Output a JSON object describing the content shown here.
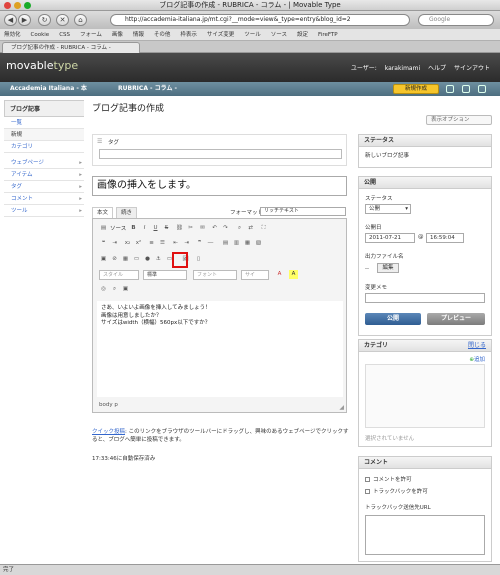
{
  "window": {
    "title": "ブログ記事の作成 - RUBRICA - コラム - | Movable Type"
  },
  "browser": {
    "url": "http://accademia-italiana.jp/mt.cgi?__mode=view&_type=entry&blog_id=2",
    "search_placeholder": "Google",
    "bookmarks": [
      "無効化",
      "Cookie",
      "CSS",
      "フォーム",
      "画像",
      "情報",
      "その他",
      "枠表示",
      "サイズ変更",
      "ツール",
      "ソース",
      "設定",
      "FireFTP"
    ],
    "tab_title": "ブログ記事の作成 - RUBRICA - コラム -",
    "status": "完了"
  },
  "app": {
    "logo_main": "movable",
    "logo_accent": "type",
    "user_label": "ユーザー:",
    "username": "karakimami",
    "help": "ヘルプ",
    "signout": "サインアウト",
    "blog_left": "Accademia Italiana - 本",
    "blog_right": "RUBRICA - コラム -",
    "new_button": "新規作成"
  },
  "sidebar": {
    "heading": "ブログ記事",
    "items": [
      {
        "label": "一覧",
        "active": true
      },
      {
        "label": "新規",
        "active": false
      },
      {
        "label": "カテゴリ",
        "active": true
      }
    ],
    "groups": [
      "ウェブページ",
      "アイテム",
      "タグ",
      "コメント",
      "ツール"
    ]
  },
  "page": {
    "title": "ブログ記事の作成",
    "display_options": "表示オプション",
    "tag_label": "タグ",
    "entry_title": "画像の挿入をします。",
    "tab_body": "本文",
    "tab_more": "続き",
    "format_label": "フォーマット:",
    "format_value": "リッチテキスト",
    "toolbar_source": "ソース",
    "style_placeholder": "スタイル",
    "heading_value": "標準",
    "font_placeholder": "フォント",
    "size_placeholder": "サイ",
    "body_lines": [
      "さあ、いよいよ画像を挿入してみましょう！",
      "画像は用意しましたか？",
      "サイズはwidth（横幅）560px以下ですか？"
    ],
    "editor_status": "body  p",
    "quickpost_link": "クイック投稿",
    "quickpost_text": ": このリンクをブラウザのツールバーにドラッグし、興味のあるウェブページでクリックすると、ブログへ簡単に投稿できます。",
    "autosave": "17:33:46に自動保存済み"
  },
  "right": {
    "status_head": "ステータス",
    "status_value": "新しいブログ記事",
    "publish_head": "公開",
    "status_label": "ステータス",
    "status_select": "公開",
    "date_label": "公開日",
    "date": "2011-07-21",
    "at": "@",
    "time": "16:59:04",
    "filename_label": "出力ファイル名",
    "filename_dash": "--",
    "edit_btn": "編集",
    "memo_label": "変更メモ",
    "publish_btn": "公開",
    "preview_btn": "プレビュー",
    "category_head": "カテゴリ",
    "category_close": "閉じる",
    "category_add": "追加",
    "category_none": "選択されていません",
    "comment_head": "コメント",
    "allow_comments": "コメントを許可",
    "allow_tb": "トラックバックを許可",
    "tb_url_label": "トラックバック送信先URL"
  }
}
